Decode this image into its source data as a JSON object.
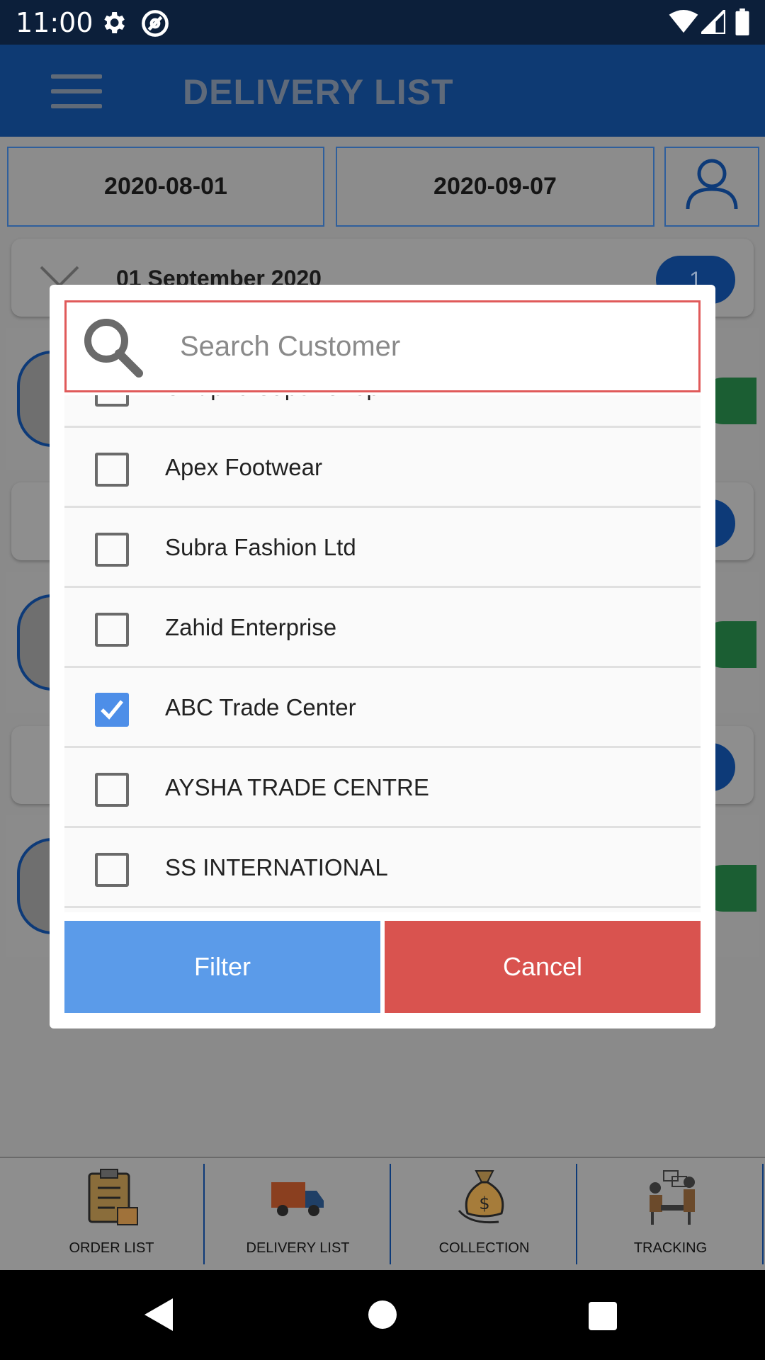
{
  "status_bar": {
    "time": "11:00"
  },
  "app_bar": {
    "title": "DELIVERY LIST"
  },
  "filters": {
    "start_date": "2020-08-01",
    "end_date": "2020-09-07"
  },
  "background_list": {
    "group_header": "01 September 2020",
    "group_count": "1"
  },
  "dialog": {
    "search_placeholder": "Search Customer",
    "customers": [
      {
        "name": "Swapno Super Shop",
        "checked": false
      },
      {
        "name": "Apex Footwear",
        "checked": false
      },
      {
        "name": "Subra Fashion Ltd",
        "checked": false
      },
      {
        "name": "Zahid Enterprise",
        "checked": false
      },
      {
        "name": "ABC Trade Center",
        "checked": true
      },
      {
        "name": "AYSHA TRADE CENTRE",
        "checked": false
      },
      {
        "name": "SS INTERNATIONAL",
        "checked": false
      }
    ],
    "filter_label": "Filter",
    "cancel_label": "Cancel"
  },
  "bottom_nav": [
    {
      "label": "ORDER LIST",
      "icon": "clipboard-icon"
    },
    {
      "label": "DELIVERY LIST",
      "icon": "truck-icon"
    },
    {
      "label": "COLLECTION",
      "icon": "money-bag-icon"
    },
    {
      "label": "TRACKING",
      "icon": "people-desk-icon"
    }
  ],
  "colors": {
    "app_bar": "#0e3a73",
    "status_bar": "#0c1f3a",
    "filter_button": "#5b9be9",
    "cancel_button": "#d9534f",
    "search_border": "#e05a5a",
    "checkbox_checked": "#4d8ee8"
  }
}
